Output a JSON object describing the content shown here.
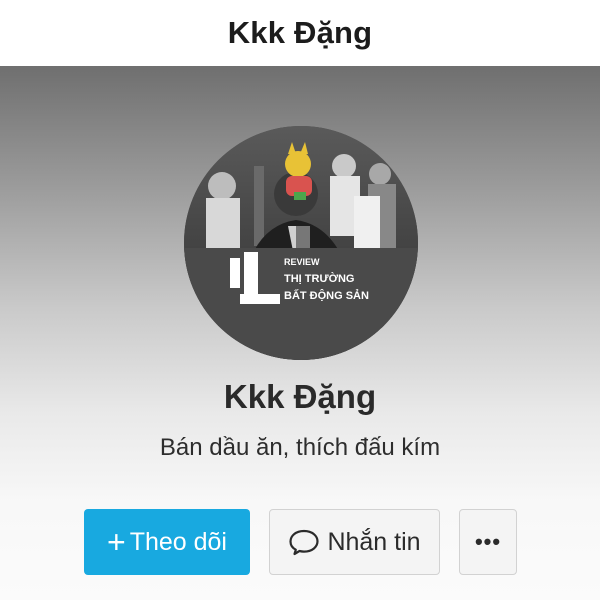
{
  "header": {
    "title": "Kkk Đặng"
  },
  "profile": {
    "name": "Kkk Đặng",
    "bio": "Bán dầu ăn, thích đấu kím",
    "avatar": {
      "overlay_label": "REVIEW",
      "overlay_line1": "THỊ TRƯỜNG",
      "overlay_line2": "BẤT ĐỘNG SẢN"
    }
  },
  "actions": {
    "follow_icon": "+",
    "follow_label": "Theo dõi",
    "message_label": "Nhắn tin",
    "more_label": "•••"
  },
  "colors": {
    "accent": "#18a9e0",
    "header_bg": "#ffffff",
    "button_bg": "#f4f4f4"
  },
  "icons": {
    "message": "chat-bubble-icon",
    "follow": "plus-icon"
  }
}
